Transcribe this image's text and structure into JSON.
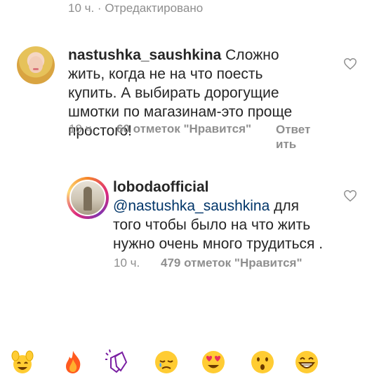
{
  "top": {
    "meta": "10 ч. · Отредактировано"
  },
  "comments": [
    {
      "username": "nastushka_saushkina",
      "text": " Сложно жить, когда не на что поесть купить. А выбирать дорогущие шмотки по магазинам-это проще простого!",
      "time": "10 ч.",
      "likes": "60 отметок \"Нравится\"",
      "reply": "Ответить",
      "reply_line1": "Ответ",
      "reply_line2": "ить"
    },
    {
      "username": "lobodaofficial",
      "mention": "@nastushka_saushkina",
      "text": " для того чтобы было на что жить нужно очень много трудиться .",
      "time": "10 ч.",
      "likes": "479 отметок \"Нравится\""
    }
  ],
  "emoji_bar": [
    "raised-hands-icon",
    "fire-icon",
    "clapping-hands-icon",
    "crying-face-icon",
    "heart-eyes-icon",
    "surprised-face-icon",
    "grinning-face-icon"
  ],
  "colors": {
    "text": "#262626",
    "muted": "#8e8e8e",
    "mention": "#003569"
  }
}
